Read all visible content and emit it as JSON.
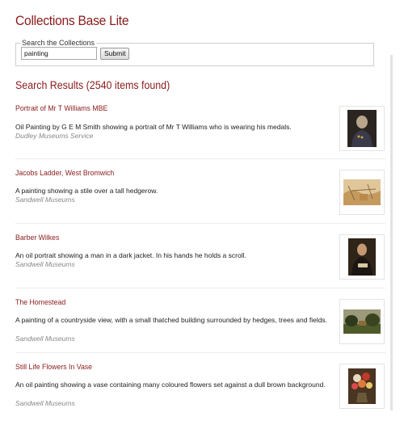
{
  "app": {
    "title": "Collections Base Lite"
  },
  "search": {
    "legend": "Search the Collections",
    "value": "painting",
    "submit_label": "Submit"
  },
  "results_heading": "Search Results (2540 items found)",
  "results": [
    {
      "title": "Portrait of Mr T Williams MBE",
      "description": "Oil Painting by G E M Smith showing a portrait of Mr T Williams who is wearing his medals.",
      "source": "Dudley Museums Service",
      "thumbnail_icon": "portrait-painting"
    },
    {
      "title": "Jacobs Ladder, West Bromwich",
      "description": "A painting showing a stile over a tall hedgerow.",
      "source": "Sandwell Museums",
      "thumbnail_icon": "landscape-sketch"
    },
    {
      "title": "Barber Wilkes",
      "description": "An oil portrait showing a man in a dark jacket. In his hands he holds a scroll.",
      "source": "Sandwell Museums",
      "thumbnail_icon": "portrait-painting"
    },
    {
      "title": "The Homestead",
      "description": "A painting of a countryside view, with a small thatched building surrounded by hedges, trees and fields.",
      "source": "Sandwell Museums",
      "thumbnail_icon": "landscape-painting"
    },
    {
      "title": "Still Life Flowers In Vase",
      "description": "An oil painting showing a vase containing many coloured flowers set against a dull brown background.",
      "source": "Sandwell Museums",
      "thumbnail_icon": "flower-still-life"
    }
  ],
  "colors": {
    "accent": "#8a1b1b",
    "source_text": "#888888",
    "border": "#cfcfcf"
  }
}
